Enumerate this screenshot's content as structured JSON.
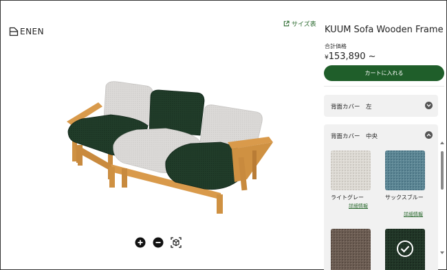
{
  "brand": {
    "logo_text": "ENEN"
  },
  "size_chart": {
    "label": "サイズ表"
  },
  "product": {
    "title": "KUUM Sofa Wooden Frame",
    "price_label": "合計価格",
    "price_currency": "¥",
    "price_value": "153,890 ~",
    "add_to_cart_label": "カートに入れる"
  },
  "options": {
    "back_cover_left": {
      "label": "背面カバー　左",
      "state": "collapsed"
    },
    "back_cover_center": {
      "label": "背面カバー　中央",
      "state": "expanded",
      "swatches": [
        {
          "name": "ライトグレー",
          "detail_link": "詳細情報",
          "selected": false
        },
        {
          "name": "サックスブルー",
          "detail_link": "詳細情報",
          "selected": false
        },
        {
          "name": "",
          "detail_link": "",
          "selected": false
        },
        {
          "name": "",
          "detail_link": "",
          "selected": true
        }
      ]
    }
  },
  "viewer_controls": [
    "zoom-in",
    "zoom-out",
    "reset-view"
  ],
  "colors": {
    "accent_green": "#1f5e2a",
    "link_green": "#2b6a2f",
    "fabric_dark_green": "#1f3a27",
    "fabric_light_gray": "#d9d7d5",
    "wood": "#d99a4b"
  }
}
